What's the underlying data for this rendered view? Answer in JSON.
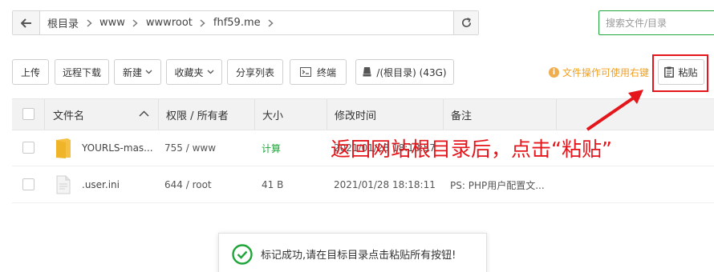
{
  "path": {
    "crumbs": [
      "根目录",
      "www",
      "wwwroot",
      "fhf59.me"
    ]
  },
  "search": {
    "placeholder": "搜索文件/目录"
  },
  "toolbar": {
    "upload": "上传",
    "remote_download": "远程下载",
    "new": "新建",
    "favorites": "收藏夹",
    "share_list": "分享列表",
    "terminal": "终端",
    "disk": "/(根目录) (43G)",
    "hint": "文件操作可使用右键",
    "paste": "粘贴"
  },
  "table": {
    "headers": {
      "name": "文件名",
      "perm": "权限 / 所有者",
      "size": "大小",
      "mtime": "修改时间",
      "note": "备注"
    },
    "rows": [
      {
        "name": "YOURLS-mas...",
        "perm": "755 / www",
        "size": "计算",
        "mtime": "2021/01/28 18:18:57",
        "note": ""
      },
      {
        "name": ".user.ini",
        "perm": "644 / root",
        "size": "41 B",
        "mtime": "2021/01/28 18:18:11",
        "note": "PS: PHP用户配置文..."
      }
    ]
  },
  "annotation": "返回网站根目录后，点击“粘贴”",
  "toast": "标记成功,请在目标目录点击粘贴所有按钮!",
  "colors": {
    "accent": "#20a53a",
    "annotation": "#e4161b",
    "hint": "#f0a020"
  }
}
